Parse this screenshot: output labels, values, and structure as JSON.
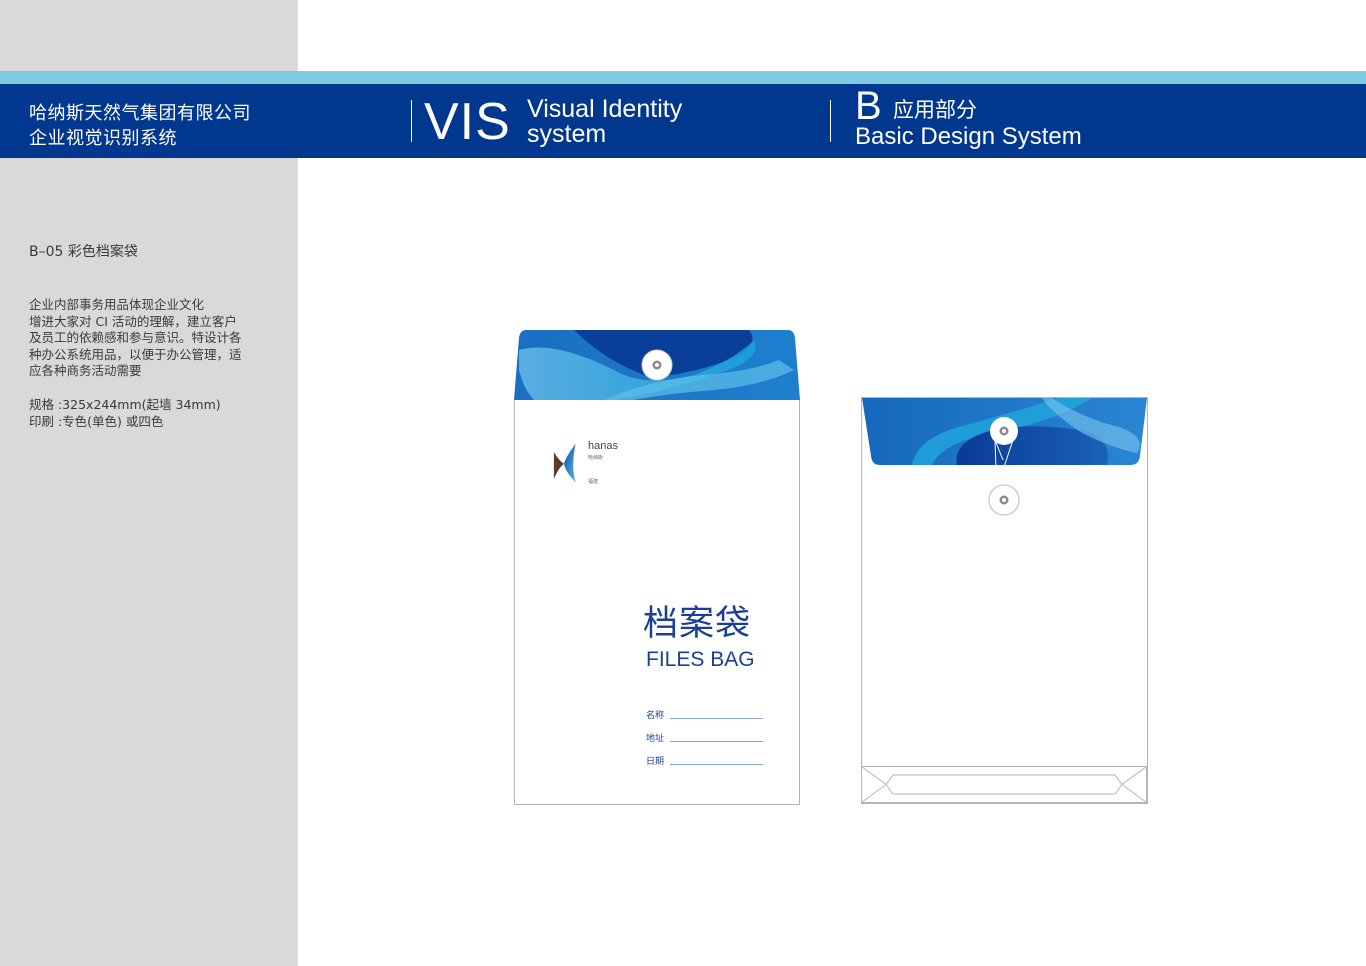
{
  "header": {
    "company_line1": "哈纳斯天然气集团有限公司",
    "company_line2": "企业视觉识别系统",
    "vis_abbr": "VIS",
    "vis_line1": "Visual Identity",
    "vis_line2": "system",
    "section_letter": "B",
    "section_cn": "应用部分",
    "section_en": "Basic Design System"
  },
  "sidebar": {
    "section_title": "B–05 彩色档案袋",
    "description": [
      "企业内部事务用品体现企业文化",
      "增进大家对 CI 活动的理解，建立客户",
      "及员工的依赖感和参与意识。特设计各",
      "种办公系统用品，以便于办公管理，适",
      "应各种商务活动需要"
    ],
    "spec_size": "规格 :325x244mm(起墙 34mm)",
    "spec_print": "印刷 :专色(单色) 或四色"
  },
  "envelope_front": {
    "logo_text": "hanas",
    "logo_cn": "哈纳斯",
    "logo_sub": "福建",
    "title_cn": "档案袋",
    "title_en": "FILES BAG",
    "fields": [
      {
        "label": "名称"
      },
      {
        "label": "地址"
      },
      {
        "label": "日期"
      }
    ]
  },
  "colors": {
    "band_dark": "#00388f",
    "band_light": "#7fcbe2",
    "sidebar_bg": "#d9d9d9",
    "brand_blue": "#1b3f96"
  }
}
